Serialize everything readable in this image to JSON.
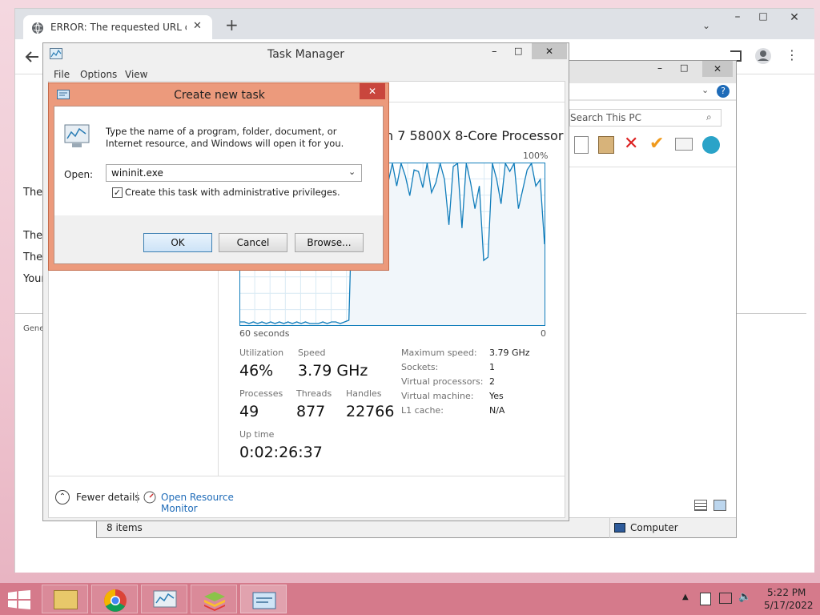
{
  "chrome": {
    "tab_title": "ERROR: The requested URL could",
    "new_tab": "+",
    "page_lines": [
      "The",
      "The",
      "The",
      "Your"
    ],
    "page_footer": "Gene"
  },
  "explorer": {
    "search_placeholder": "Search This PC",
    "status_items": "8 items",
    "status_location": "Computer"
  },
  "task_manager": {
    "title": "Task Manager",
    "menu": [
      "File",
      "Options",
      "View"
    ],
    "processor_name": "n 7 5800X 8-Core Processor",
    "graph_max": "100%",
    "graph_left": "60 seconds",
    "graph_right": "0",
    "utilization_label": "Utilization",
    "utilization": "46%",
    "speed_label": "Speed",
    "speed": "3.79 GHz",
    "processes_label": "Processes",
    "processes": "49",
    "threads_label": "Threads",
    "threads": "877",
    "handles_label": "Handles",
    "handles": "22766",
    "uptime_label": "Up time",
    "uptime": "0:02:26:37",
    "specs": [
      {
        "k": "Maximum speed:",
        "v": "3.79 GHz"
      },
      {
        "k": "Sockets:",
        "v": "1"
      },
      {
        "k": "Virtual processors:",
        "v": "2"
      },
      {
        "k": "Virtual machine:",
        "v": "Yes"
      },
      {
        "k": "L1 cache:",
        "v": "N/A"
      }
    ],
    "fewer_details": "Fewer details",
    "open_resource_monitor": "Open Resource Monitor",
    "chart_data": {
      "type": "line",
      "ylim": [
        0,
        100
      ],
      "values": [
        2,
        2,
        1,
        2,
        1,
        2,
        1,
        2,
        1,
        2,
        1,
        2,
        1,
        2,
        1,
        2,
        1,
        1,
        1,
        2,
        1,
        2,
        2,
        1,
        2,
        3,
        100,
        87,
        70,
        100,
        85,
        95,
        100,
        72,
        88,
        100,
        86,
        100,
        92,
        80,
        96,
        95,
        85,
        100,
        82,
        88,
        100,
        90,
        62,
        98,
        100,
        60,
        100,
        88,
        72,
        86,
        40,
        42,
        100,
        90,
        75,
        100,
        95,
        100,
        72,
        84,
        96,
        100,
        86,
        90,
        50
      ]
    }
  },
  "dialog": {
    "title": "Create new task",
    "description": "Type the name of a program, folder, document, or Internet resource, and Windows will open it for you.",
    "open_label": "Open:",
    "open_value": "wininit.exe",
    "admin_checkbox": "Create this task with administrative privileges.",
    "ok": "OK",
    "cancel": "Cancel",
    "browse": "Browse...",
    "close": "✕"
  },
  "taskbar": {
    "time": "5:22 PM",
    "date": "5/17/2022"
  },
  "colors": {
    "dialog_title_bg": "#ec9a7c",
    "graph_line": "#117dbb",
    "graph_fill": "#f1f6fa",
    "link": "#1e6bb8"
  }
}
